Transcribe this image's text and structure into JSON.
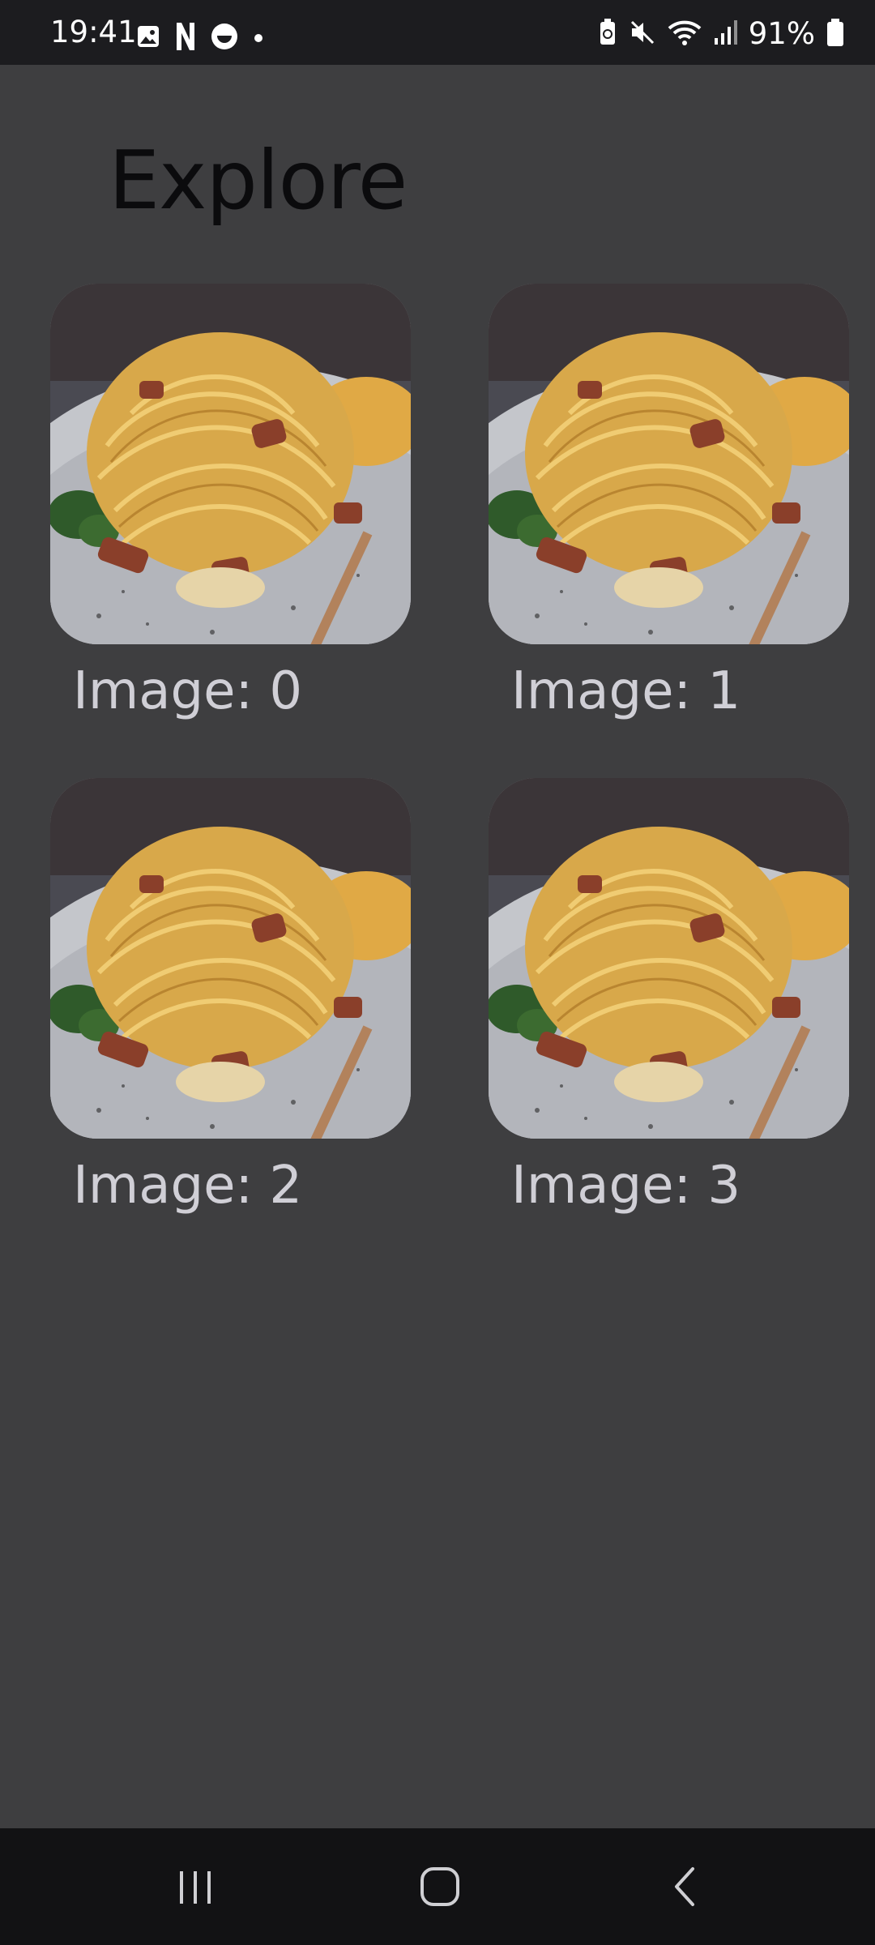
{
  "status_bar": {
    "time": "19:41",
    "battery_percent": "91%",
    "left_icons": [
      "gallery-icon",
      "netflix-icon",
      "smiley-icon",
      "dot-icon"
    ],
    "right_icons": [
      "battery-saver-icon",
      "mute-icon",
      "wifi-icon",
      "signal-icon",
      "battery-icon"
    ]
  },
  "page": {
    "title": "Explore"
  },
  "grid": {
    "items": [
      {
        "label": "Image: 0"
      },
      {
        "label": "Image: 1"
      },
      {
        "label": "Image: 2"
      },
      {
        "label": "Image: 3"
      }
    ]
  },
  "nav_bar": {
    "buttons": [
      "recent-apps-icon",
      "home-icon",
      "back-icon"
    ]
  },
  "colors": {
    "background": "#3e3e40",
    "status_bar": "#1c1c1f",
    "nav_bar": "#121214",
    "title": "#0b0b0d",
    "caption": "#d0cfd6"
  }
}
